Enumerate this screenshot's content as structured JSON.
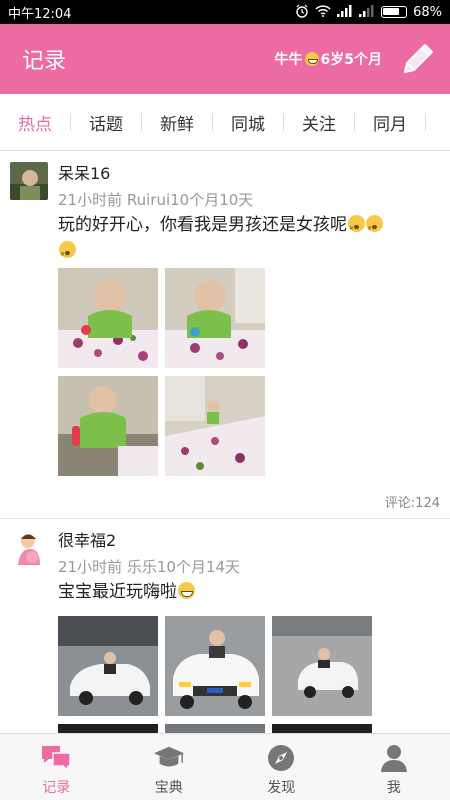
{
  "status_bar": {
    "time": "中午12:04",
    "battery": "68%"
  },
  "header": {
    "title": "记录",
    "baby_name": "牛牛",
    "baby_age": "6岁5个月"
  },
  "tabs": [
    {
      "label": "热点",
      "active": true
    },
    {
      "label": "话题",
      "active": false
    },
    {
      "label": "新鲜",
      "active": false
    },
    {
      "label": "同城",
      "active": false
    },
    {
      "label": "关注",
      "active": false
    },
    {
      "label": "同月",
      "active": false
    }
  ],
  "posts": [
    {
      "user": "呆呆16",
      "meta": "21小时前 Ruirui10个月10天",
      "text": "玩的好开心，你看我是男孩还是女孩呢",
      "emoji": "dizzy-face",
      "comments": "评论:124"
    },
    {
      "user": "很幸福2",
      "meta": "21小时前 乐乐10个月14天",
      "text": "宝宝最近玩嗨啦",
      "emoji": "grinning-face",
      "comments": ""
    }
  ],
  "bottom_nav": [
    {
      "label": "记录",
      "icon": "chat-bubbles-icon",
      "active": true
    },
    {
      "label": "宝典",
      "icon": "graduation-cap-icon",
      "active": false
    },
    {
      "label": "发现",
      "icon": "compass-icon",
      "active": false
    },
    {
      "label": "我",
      "icon": "person-icon",
      "active": false
    }
  ],
  "colors": {
    "accent": "#ec6ba2",
    "status_bar": "#000000",
    "secondary_text": "#999999"
  }
}
